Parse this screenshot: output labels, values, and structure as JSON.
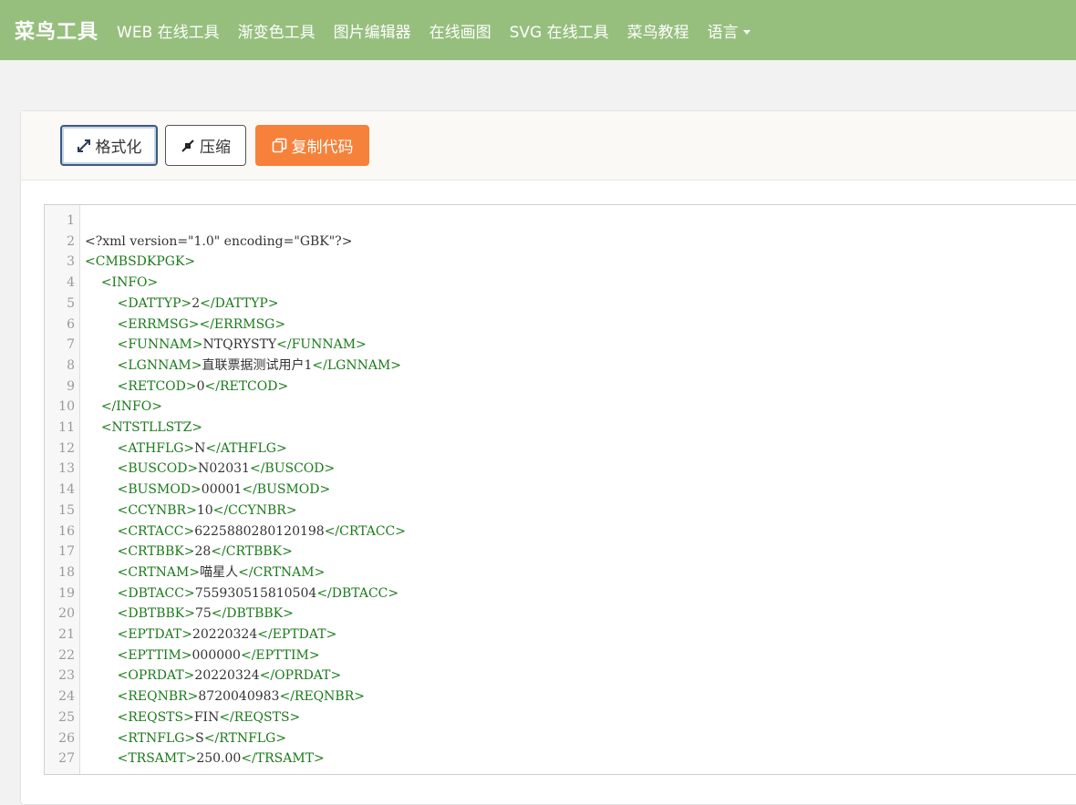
{
  "header": {
    "brand": "菜鸟工具",
    "nav": [
      "WEB 在线工具",
      "渐变色工具",
      "图片编辑器",
      "在线画图",
      "SVG 在线工具",
      "菜鸟教程"
    ],
    "lang_label": "语言"
  },
  "toolbar": {
    "format_label": "格式化",
    "compress_label": "压缩",
    "copy_label": "复制代码"
  },
  "colors": {
    "header_bg": "#96bf7e",
    "copy_button": "#f6813a",
    "xml_tag": "#1a7a1a"
  },
  "editor": {
    "lines": [
      {
        "n": "1",
        "indent": "",
        "tag": "",
        "text": "",
        "close": ""
      },
      {
        "n": "2",
        "indent": "",
        "tag": "",
        "text": "<?xml version=\"1.0\" encoding=\"GBK\"?>",
        "close": ""
      },
      {
        "n": "3",
        "indent": "",
        "tag": "<CMBSDKPGK>",
        "text": "",
        "close": ""
      },
      {
        "n": "4",
        "indent": "    ",
        "tag": "<INFO>",
        "text": "",
        "close": ""
      },
      {
        "n": "5",
        "indent": "        ",
        "tag": "<DATTYP>",
        "text": "2",
        "close": "</DATTYP>"
      },
      {
        "n": "6",
        "indent": "        ",
        "tag": "<ERRMSG>",
        "text": "",
        "close": "</ERRMSG>"
      },
      {
        "n": "7",
        "indent": "        ",
        "tag": "<FUNNAM>",
        "text": "NTQRYSTY",
        "close": "</FUNNAM>"
      },
      {
        "n": "8",
        "indent": "        ",
        "tag": "<LGNNAM>",
        "text": "直联票据测试用户1",
        "close": "</LGNNAM>"
      },
      {
        "n": "9",
        "indent": "        ",
        "tag": "<RETCOD>",
        "text": "0",
        "close": "</RETCOD>"
      },
      {
        "n": "10",
        "indent": "    ",
        "tag": "</INFO>",
        "text": "",
        "close": ""
      },
      {
        "n": "11",
        "indent": "    ",
        "tag": "<NTSTLLSTZ>",
        "text": "",
        "close": ""
      },
      {
        "n": "12",
        "indent": "        ",
        "tag": "<ATHFLG>",
        "text": "N",
        "close": "</ATHFLG>"
      },
      {
        "n": "13",
        "indent": "        ",
        "tag": "<BUSCOD>",
        "text": "N02031",
        "close": "</BUSCOD>"
      },
      {
        "n": "14",
        "indent": "        ",
        "tag": "<BUSMOD>",
        "text": "00001",
        "close": "</BUSMOD>"
      },
      {
        "n": "15",
        "indent": "        ",
        "tag": "<CCYNBR>",
        "text": "10",
        "close": "</CCYNBR>"
      },
      {
        "n": "16",
        "indent": "        ",
        "tag": "<CRTACC>",
        "text": "6225880280120198",
        "close": "</CRTACC>"
      },
      {
        "n": "17",
        "indent": "        ",
        "tag": "<CRTBBK>",
        "text": "28",
        "close": "</CRTBBK>"
      },
      {
        "n": "18",
        "indent": "        ",
        "tag": "<CRTNAM>",
        "text": "喵星人",
        "close": "</CRTNAM>"
      },
      {
        "n": "19",
        "indent": "        ",
        "tag": "<DBTACC>",
        "text": "755930515810504",
        "close": "</DBTACC>"
      },
      {
        "n": "20",
        "indent": "        ",
        "tag": "<DBTBBK>",
        "text": "75",
        "close": "</DBTBBK>"
      },
      {
        "n": "21",
        "indent": "        ",
        "tag": "<EPTDAT>",
        "text": "20220324",
        "close": "</EPTDAT>"
      },
      {
        "n": "22",
        "indent": "        ",
        "tag": "<EPTTIM>",
        "text": "000000",
        "close": "</EPTTIM>"
      },
      {
        "n": "23",
        "indent": "        ",
        "tag": "<OPRDAT>",
        "text": "20220324",
        "close": "</OPRDAT>"
      },
      {
        "n": "24",
        "indent": "        ",
        "tag": "<REQNBR>",
        "text": "8720040983",
        "close": "</REQNBR>"
      },
      {
        "n": "25",
        "indent": "        ",
        "tag": "<REQSTS>",
        "text": "FIN",
        "close": "</REQSTS>"
      },
      {
        "n": "26",
        "indent": "        ",
        "tag": "<RTNFLG>",
        "text": "S",
        "close": "</RTNFLG>"
      },
      {
        "n": "27",
        "indent": "        ",
        "tag": "<TRSAMT>",
        "text": "250.00",
        "close": "</TRSAMT>"
      }
    ]
  }
}
